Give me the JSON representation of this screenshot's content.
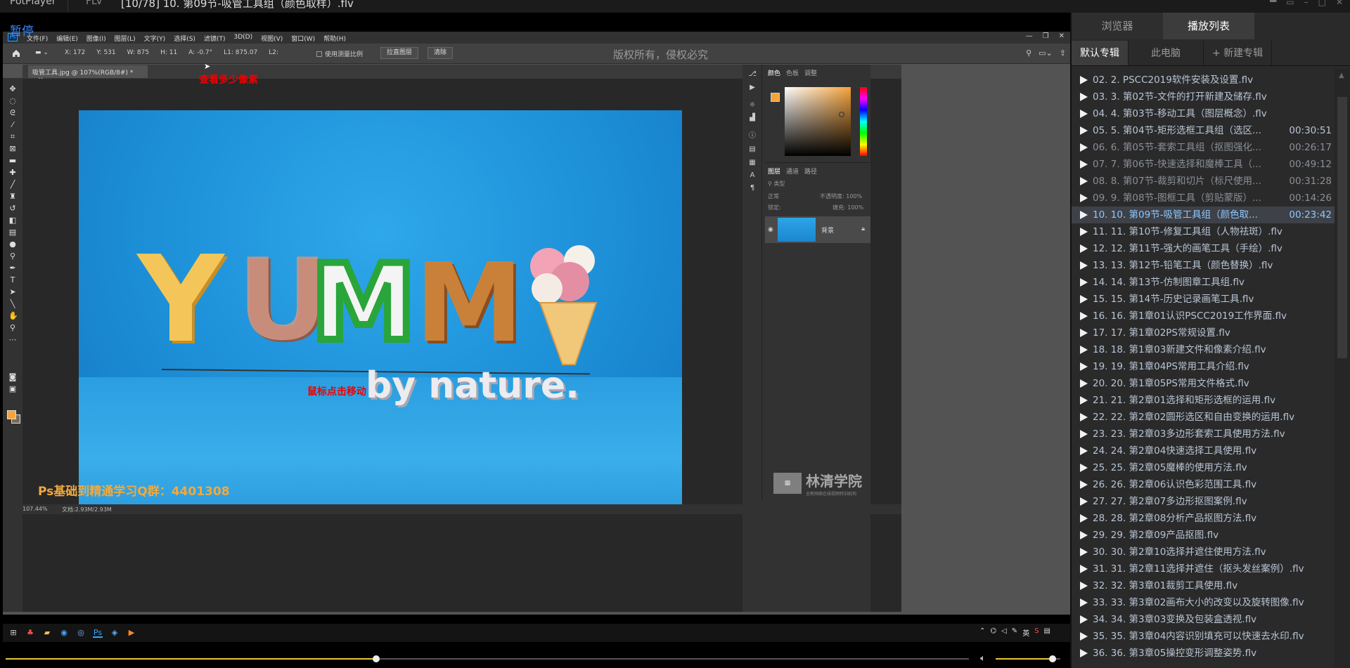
{
  "player": {
    "app_name": "PotPlayer",
    "format": "FLV",
    "title": "[10/78] 10. 第09节-吸管工具组（颜色取样）.flv",
    "pause_label": "暂停"
  },
  "photoshop": {
    "menu": [
      "文件(F)",
      "编辑(E)",
      "图像(I)",
      "图层(L)",
      "文字(Y)",
      "选择(S)",
      "滤镜(T)",
      "3D(D)",
      "视图(V)",
      "窗口(W)",
      "帮助(H)"
    ],
    "options": {
      "x": "X: 172",
      "y": "Y: 531",
      "w": "W: 875",
      "h": "H: 11",
      "a": "A: -0.7°",
      "l1": "L1: 875.07",
      "l2": "L2:",
      "use_scale": "使用测量比例",
      "straighten": "拉直图层",
      "clear": "清除",
      "watermark": "版权所有，侵权必究"
    },
    "doc_tab": "吸管工具.jpg @ 107%(RGB/8#) *",
    "status_zoom": "107.44%",
    "status_doc": "文档:2.93M/2.93M",
    "panels": {
      "color_tabs": [
        "颜色",
        "色板",
        "调整"
      ],
      "layer_tabs": [
        "图层",
        "通道",
        "路径"
      ],
      "kind": "类型",
      "blend_mode": "正常",
      "opacity_label": "不透明度:",
      "opacity": "100%",
      "lock_label": "锁定:",
      "fill_label": "填充:",
      "fill": "100%",
      "layer_name": "背景"
    },
    "colors": {
      "foreground": "#f3a53b"
    }
  },
  "image": {
    "letters": [
      "Y",
      "U",
      "M",
      "M"
    ],
    "tagline": "by nature."
  },
  "annotations": {
    "check_pixels": "查看多少像素",
    "click_move": "鼠标点击移动",
    "promo": "Ps基础到精通学习Q群：4401308",
    "logo_big": "林清学院",
    "logo_small": "全新网络在线视频特训机构"
  },
  "taskbar": {
    "tray_lang": "英"
  },
  "seek": {
    "progress": 0.385,
    "volume": 0.88
  },
  "playlist": {
    "tabs": [
      "浏览器",
      "播放列表"
    ],
    "subtabs": [
      "默认专辑",
      "此电脑",
      "+ 新建专辑"
    ],
    "items": [
      {
        "title": "02. 2. PSCC2019软件安装及设置.flv",
        "duration": "",
        "state": "normal"
      },
      {
        "title": "03. 3. 第02节-文件的打开新建及储存.flv",
        "duration": "",
        "state": "normal"
      },
      {
        "title": "04. 4. 第03节-移动工具（图层概念）.flv",
        "duration": "",
        "state": "normal"
      },
      {
        "title": "05. 5. 第04节-矩形选框工具组（选区...",
        "duration": "00:30:51",
        "state": "normal"
      },
      {
        "title": "06. 6. 第05节-套索工具组（抠图强化...",
        "duration": "00:26:17",
        "state": "dim"
      },
      {
        "title": "07. 7. 第06节-快速选择和魔棒工具（...",
        "duration": "00:49:12",
        "state": "dim"
      },
      {
        "title": "08. 8. 第07节-裁剪和切片（标尺使用...",
        "duration": "00:31:28",
        "state": "dim"
      },
      {
        "title": "09. 9. 第08节-图框工具（剪贴蒙版）...",
        "duration": "00:14:26",
        "state": "dim"
      },
      {
        "title": "10. 10. 第09节-吸管工具组（颜色取...",
        "duration": "00:23:42",
        "state": "active"
      },
      {
        "title": "11. 11. 第10节-修复工具组（人物祛斑）.flv",
        "duration": "",
        "state": "normal"
      },
      {
        "title": "12. 12. 第11节-强大的画笔工具（手绘）.flv",
        "duration": "",
        "state": "normal"
      },
      {
        "title": "13. 13. 第12节-铅笔工具（颜色替换）.flv",
        "duration": "",
        "state": "normal"
      },
      {
        "title": "14. 14. 第13节-仿制图章工具组.flv",
        "duration": "",
        "state": "normal"
      },
      {
        "title": "15. 15. 第14节-历史记录画笔工具.flv",
        "duration": "",
        "state": "normal"
      },
      {
        "title": "16. 16. 第1章01认识PSCC2019工作界面.flv",
        "duration": "",
        "state": "normal"
      },
      {
        "title": "17. 17. 第1章02PS常规设置.flv",
        "duration": "",
        "state": "normal"
      },
      {
        "title": "18. 18. 第1章03新建文件和像素介绍.flv",
        "duration": "",
        "state": "normal"
      },
      {
        "title": "19. 19. 第1章04PS常用工具介绍.flv",
        "duration": "",
        "state": "normal"
      },
      {
        "title": "20. 20. 第1章05PS常用文件格式.flv",
        "duration": "",
        "state": "normal"
      },
      {
        "title": "21. 21. 第2章01选择和矩形选框的运用.flv",
        "duration": "",
        "state": "normal"
      },
      {
        "title": "22. 22. 第2章02圆形选区和自由变换的运用.flv",
        "duration": "",
        "state": "normal"
      },
      {
        "title": "23. 23. 第2章03多边形套索工具使用方法.flv",
        "duration": "",
        "state": "normal"
      },
      {
        "title": "24. 24. 第2章04快速选择工具使用.flv",
        "duration": "",
        "state": "normal"
      },
      {
        "title": "25. 25. 第2章05魔棒的使用方法.flv",
        "duration": "",
        "state": "normal"
      },
      {
        "title": "26. 26. 第2章06认识色彩范围工具.flv",
        "duration": "",
        "state": "normal"
      },
      {
        "title": "27. 27. 第2章07多边形抠图案例.flv",
        "duration": "",
        "state": "normal"
      },
      {
        "title": "28. 28. 第2章08分析产品抠图方法.flv",
        "duration": "",
        "state": "normal"
      },
      {
        "title": "29. 29. 第2章09产品抠图.flv",
        "duration": "",
        "state": "normal"
      },
      {
        "title": "30. 30. 第2章10选择并遮住使用方法.flv",
        "duration": "",
        "state": "normal"
      },
      {
        "title": "31. 31. 第2章11选择并遮住（抠头发丝案例）.flv",
        "duration": "",
        "state": "normal"
      },
      {
        "title": "32. 32. 第3章01裁剪工具使用.flv",
        "duration": "",
        "state": "normal"
      },
      {
        "title": "33. 33. 第3章02画布大小的改变以及旋转图像.flv",
        "duration": "",
        "state": "normal"
      },
      {
        "title": "34. 34. 第3章03变换及包装盒透视.flv",
        "duration": "",
        "state": "normal"
      },
      {
        "title": "35. 35. 第3章04内容识别填充可以快速去水印.flv",
        "duration": "",
        "state": "normal"
      },
      {
        "title": "36. 36. 第3章05操控变形调整姿势.flv",
        "duration": "",
        "state": "normal"
      }
    ]
  }
}
